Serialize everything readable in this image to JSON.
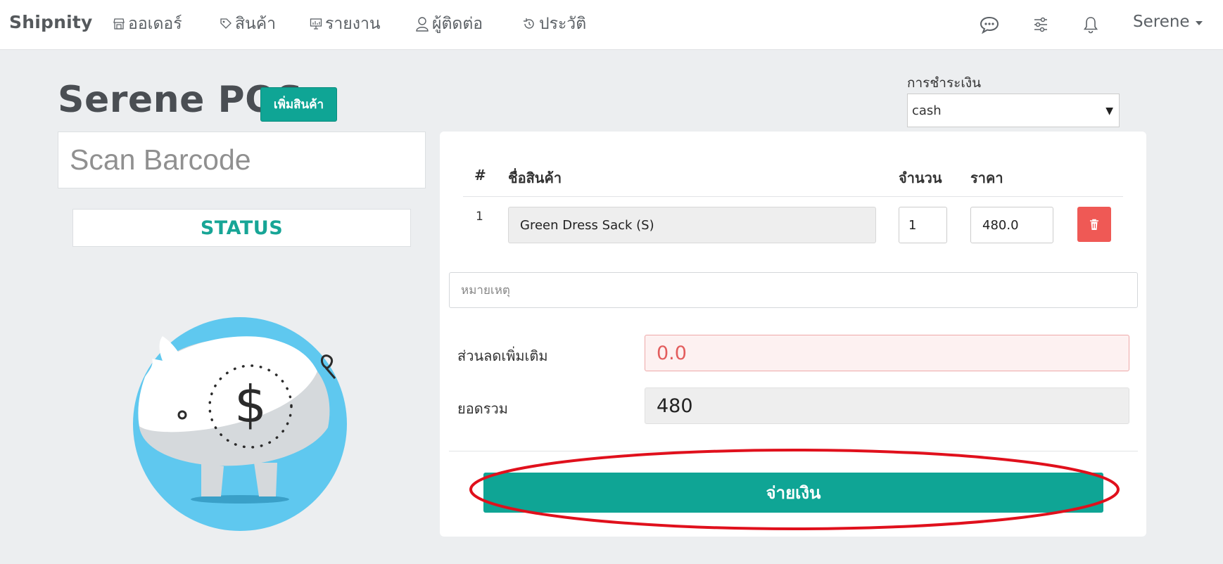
{
  "navbar": {
    "brand": "Shipnity",
    "items": [
      {
        "label": "ออเดอร์",
        "icon": "store-icon"
      },
      {
        "label": "สินค้า",
        "icon": "tag-icon"
      },
      {
        "label": "รายงาน",
        "icon": "monitor-chart-icon"
      },
      {
        "label": "ผู้ติดต่อ",
        "icon": "person-icon"
      },
      {
        "label": "ประวัติ",
        "icon": "history-icon"
      }
    ],
    "right_icons": [
      "chat-icon",
      "sliders-icon",
      "bell-icon"
    ],
    "user": "Serene"
  },
  "header": {
    "title": "Serene POS",
    "add_product_label": "เพิ่มสินค้า"
  },
  "barcode": {
    "placeholder": "Scan Barcode"
  },
  "status": {
    "label": "STATUS"
  },
  "payment": {
    "label": "การชำระเงิน",
    "selected": "cash"
  },
  "cart": {
    "headers": {
      "num": "#",
      "name": "ชื่อสินค้า",
      "qty": "จำนวน",
      "price": "ราคา"
    },
    "rows": [
      {
        "num": "1",
        "name": "Green Dress Sack (S)",
        "qty": "1",
        "price": "480.0"
      }
    ],
    "note_placeholder": "หมายเหตุ",
    "discount_label": "ส่วนลดเพิ่มเติม",
    "discount_value": "0.0",
    "total_label": "ยอดรวม",
    "total_value": "480",
    "pay_label": "จ่ายเงิน"
  },
  "colors": {
    "accent": "#0fa595",
    "danger": "#ef5955",
    "annotation": "#e0101c"
  }
}
